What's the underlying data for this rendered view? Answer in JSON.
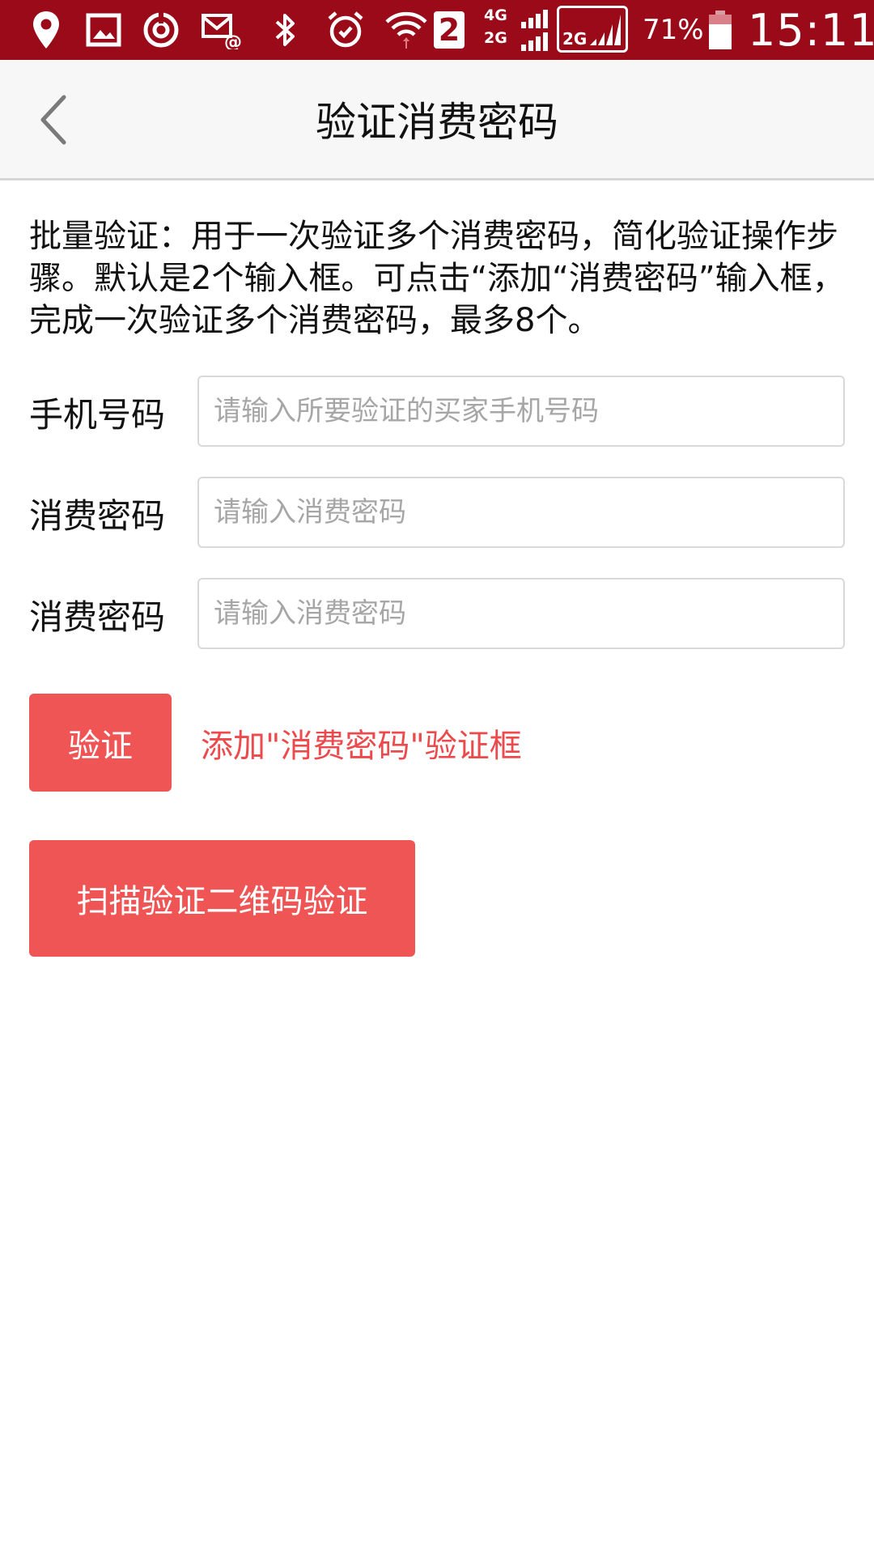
{
  "status_bar": {
    "icons": [
      "location-icon",
      "image-icon",
      "sync-icon",
      "mail-at-icon",
      "bluetooth-icon",
      "alarm-icon",
      "wifi-icon",
      "sim-2-icon",
      "signal-icon",
      "battery-icon"
    ],
    "sim_number": "2",
    "network_4g": "4G",
    "network_2g": "2G",
    "sim_box_label": "2G",
    "battery_percent": "71%",
    "time": "15:11",
    "background_color": "#9a0a18"
  },
  "header": {
    "title": "验证消费密码",
    "back_icon": "chevron-left-icon"
  },
  "description": "批量验证：用于一次验证多个消费密码，简化验证操作步骤。默认是2个输入框。可点击“添加“消费密码”输入框，完成一次验证多个消费密码，最多8个。",
  "form": {
    "phone": {
      "label": "手机号码",
      "value": "",
      "placeholder": "请输入所要验证的买家手机号码"
    },
    "passwords": [
      {
        "label": "消费密码",
        "value": "",
        "placeholder": "请输入消费密码"
      },
      {
        "label": "消费密码",
        "value": "",
        "placeholder": "请输入消费密码"
      }
    ]
  },
  "actions": {
    "verify_label": "验证",
    "add_password_label": "添加\"消费密码\"验证框",
    "scan_qr_label": "扫描验证二维码验证",
    "accent_color": "#f05556"
  }
}
